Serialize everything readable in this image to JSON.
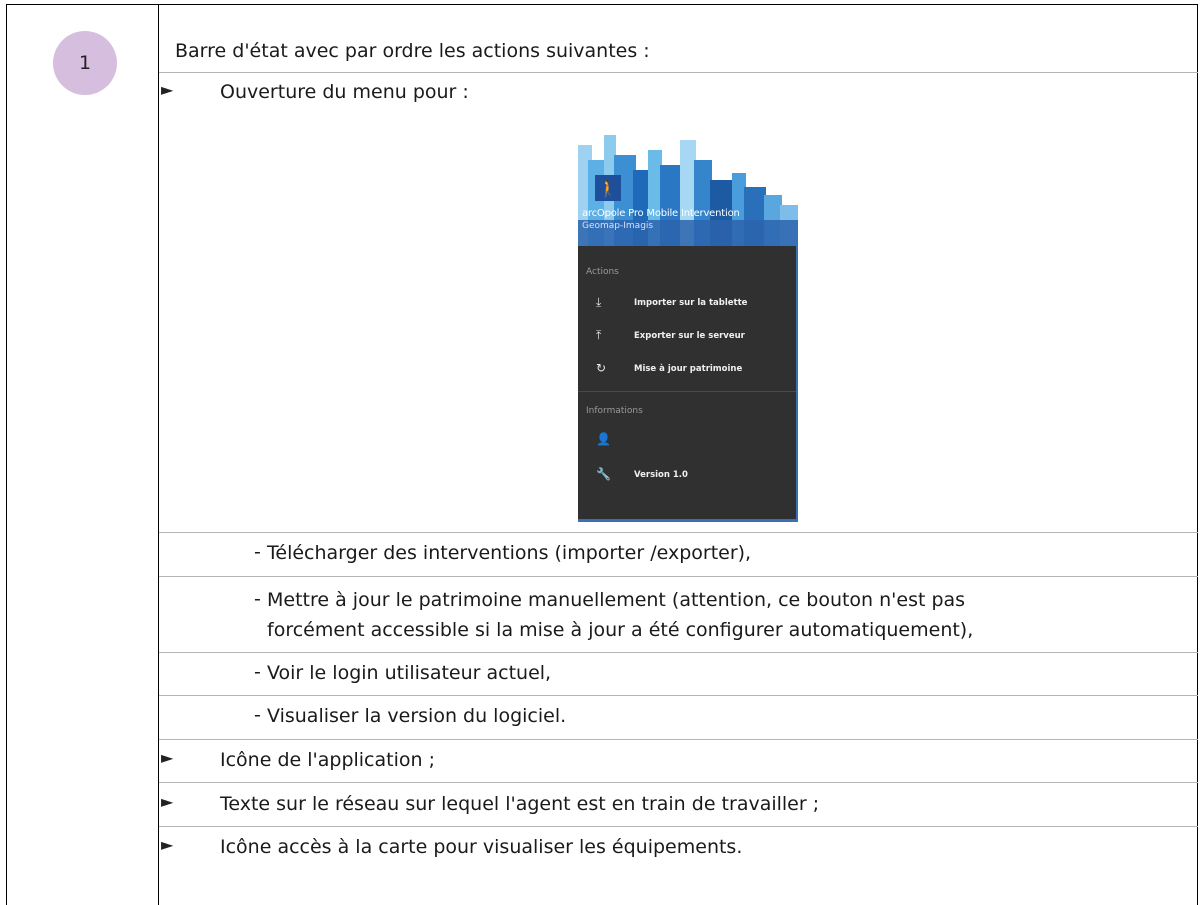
{
  "row_number": "1",
  "intro": "Barre d'état avec par ordre les actions suivantes :",
  "items": {
    "menu": "Ouverture du menu pour :",
    "app_icon": "Icône de l'application ;",
    "network_text": "Texte sur le réseau sur lequel l'agent est en train de travailler ;",
    "map_icon": "Icône accès à la carte pour visualiser les équipements."
  },
  "sub_items": {
    "download": "Télécharger des interventions (importer /exporter),",
    "update_line1": "Mettre à jour le patrimoine manuellement (attention, ce bouton n'est pas",
    "update_line2": "forcément accessible si la mise à jour a été configurer automatiquement),",
    "login": "Voir le login utilisateur actuel,",
    "version": "Visualiser la version du logiciel."
  },
  "bullet_glyph": "►",
  "dash_glyph": "-",
  "app_menu": {
    "app_name": "arcOpole Pro Mobile Intervention",
    "publisher": "Geomap-Imagis",
    "section_actions": "Actions",
    "import": "Importer sur la tablette",
    "export": "Exporter sur le serveur",
    "update": "Mise à jour patrimoine",
    "section_info": "Informations",
    "version": "Version 1.0",
    "icons": [
      "download-icon",
      "upload-icon",
      "refresh-icon",
      "person-icon",
      "wrench-icon"
    ],
    "colors": {
      "drawer_bg": "#303030",
      "header_blue": "#1e4f9b"
    }
  },
  "colors": {
    "number_circle": "#d6bedf",
    "separator": "#b5b5b5",
    "border": "#000000"
  }
}
